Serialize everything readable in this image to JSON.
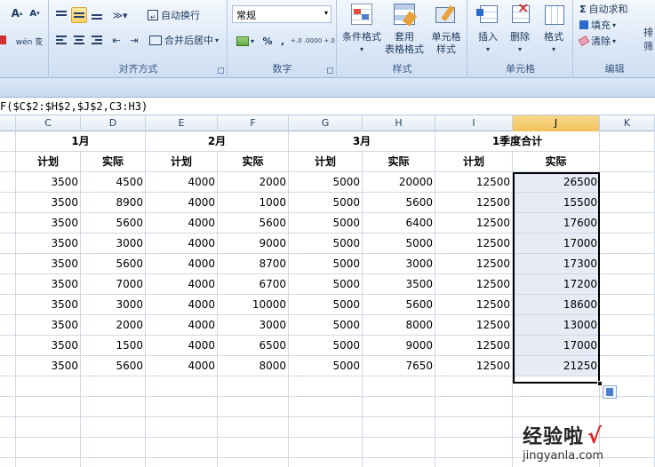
{
  "ribbon": {
    "font_group": {
      "grow_label": "A",
      "shrink_label": "A",
      "wen_label": "wén 变"
    },
    "alignment_group": {
      "label": "对齐方式",
      "wrap_text": "自动换行",
      "merge_center": "合并后居中"
    },
    "number_group": {
      "label": "数字",
      "format_value": "常规",
      "percent": "%",
      "comma": ",",
      "inc_dec": "+.0 .00",
      "dec_dec": ".00 +.0"
    },
    "styles_group": {
      "label": "样式",
      "conditional_format": "条件格式",
      "format_table_1": "套用",
      "format_table_2": "表格格式",
      "cell_styles_1": "单元格",
      "cell_styles_2": "样式"
    },
    "cells_group": {
      "label": "单元格",
      "insert": "插入",
      "delete": "删除",
      "format": "格式"
    },
    "editing_group": {
      "label": "编辑",
      "autosum": "自动求和",
      "fill": "填充",
      "clear": "清除",
      "sort": "排",
      "filter": "筛"
    }
  },
  "formula_bar": {
    "formula": "F($C$2:$H$2,$J$2,C3:H3)"
  },
  "sheet": {
    "column_letters": [
      "C",
      "D",
      "E",
      "F",
      "G",
      "H",
      "I",
      "J",
      "K"
    ],
    "selected_column": "J",
    "month_headers": [
      "1月",
      "2月",
      "3月",
      "1季度合计"
    ],
    "sub_headers": [
      "计划",
      "实际",
      "计划",
      "实际",
      "计划",
      "实际",
      "计划",
      "实际"
    ],
    "rows": [
      [
        "3500",
        "4500",
        "4000",
        "2000",
        "5000",
        "20000",
        "12500",
        "26500"
      ],
      [
        "3500",
        "8900",
        "4000",
        "1000",
        "5000",
        "5600",
        "12500",
        "15500"
      ],
      [
        "3500",
        "5600",
        "4000",
        "5600",
        "5000",
        "6400",
        "12500",
        "17600"
      ],
      [
        "3500",
        "3000",
        "4000",
        "9000",
        "5000",
        "5000",
        "12500",
        "17000"
      ],
      [
        "3500",
        "5600",
        "4000",
        "8700",
        "5000",
        "3000",
        "12500",
        "17300"
      ],
      [
        "3500",
        "7000",
        "4000",
        "6700",
        "5000",
        "3500",
        "12500",
        "17200"
      ],
      [
        "3500",
        "3000",
        "4000",
        "10000",
        "5000",
        "5600",
        "12500",
        "18600"
      ],
      [
        "3500",
        "2000",
        "4000",
        "3000",
        "5000",
        "8000",
        "12500",
        "13000"
      ],
      [
        "3500",
        "1500",
        "4000",
        "6500",
        "5000",
        "9000",
        "12500",
        "17000"
      ],
      [
        "3500",
        "5600",
        "4000",
        "8000",
        "5000",
        "7650",
        "12500",
        "21250"
      ]
    ]
  },
  "watermark": {
    "brand": "经验啦",
    "check": "√",
    "url": "jingyanla.com"
  },
  "colors": {
    "selection_fill": "#e6ebf5",
    "ribbon_bg": "#dbe7f6",
    "header_highlight": "#f1c15f"
  },
  "icons": [
    "align-top-icon",
    "align-middle-icon",
    "align-bottom-icon",
    "orientation-icon",
    "wrap-text-icon",
    "merge-center-icon",
    "currency-icon",
    "conditional-format-icon",
    "format-table-icon",
    "cell-styles-icon",
    "insert-cells-icon",
    "delete-cells-icon",
    "format-cells-icon",
    "autosum-icon",
    "fill-icon",
    "clear-icon",
    "paste-options-icon"
  ]
}
